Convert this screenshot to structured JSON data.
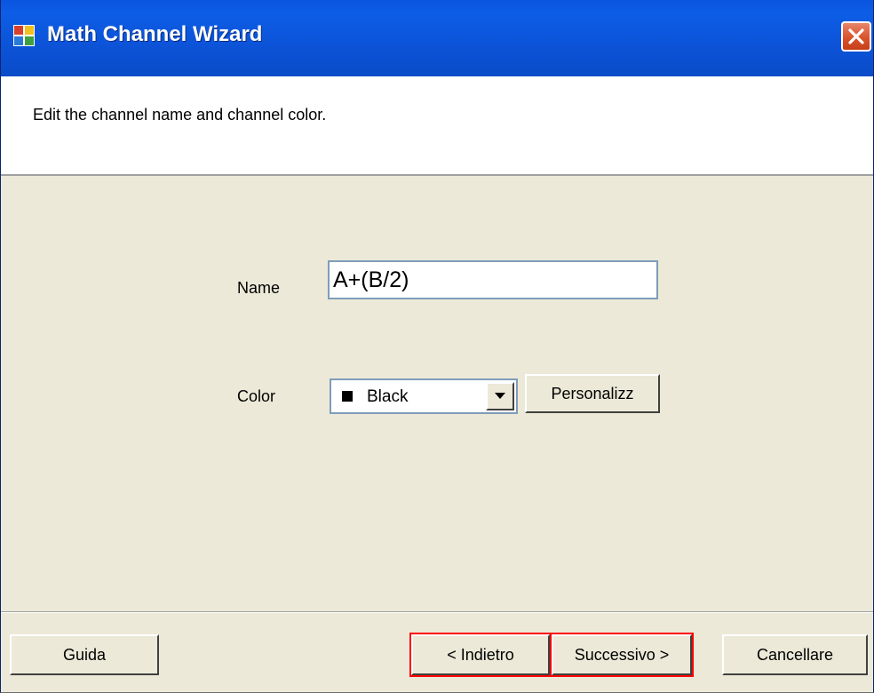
{
  "window": {
    "title": "Math Channel Wizard",
    "accent_color": "#0a55e0",
    "close_icon": "close-icon"
  },
  "header": {
    "instruction": "Edit the channel name and channel color."
  },
  "form": {
    "name_label": "Name",
    "name_value": "A+(B/2)",
    "color_label": "Color",
    "color_value": "Black",
    "color_swatch": "#000000",
    "customize_label": "Personalizz"
  },
  "footer": {
    "help_label": "Guida",
    "back_label": "< Indietro",
    "next_label": "Successivo >",
    "cancel_label": "Cancellare",
    "highlight_color": "#ff0000"
  }
}
